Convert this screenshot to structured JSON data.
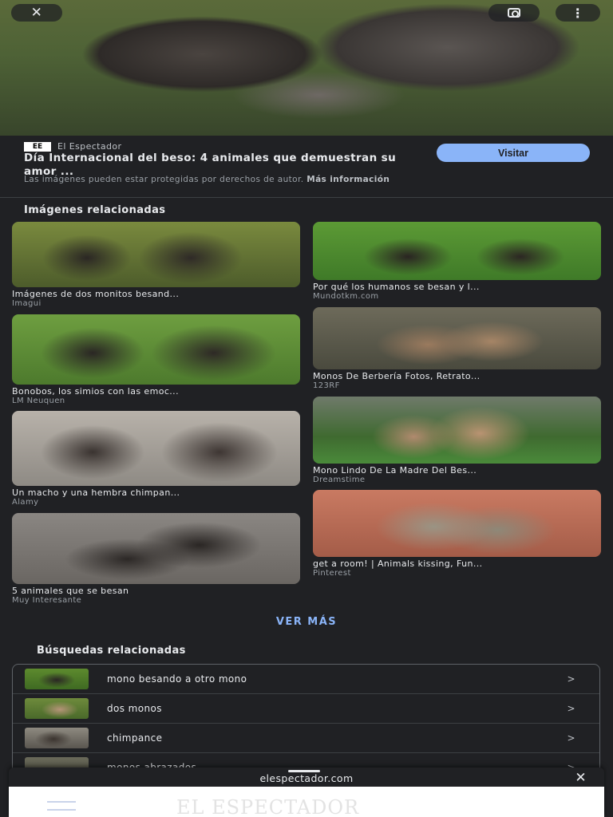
{
  "header": {
    "close_icon": "close-icon",
    "lens_icon": "google-lens-icon",
    "more_icon": "more-vert-icon",
    "close_glyph": "✕",
    "more_glyph": "⋮"
  },
  "source": {
    "logo_text": "EE",
    "name": "El Espectador",
    "title": "Día Internacional del beso: 4 animales que demuestran su amor ...",
    "visit_label": "Visitar",
    "copyright_text": "Las imágenes pueden estar protegidas por derechos de autor.",
    "more_info_label": "Más información"
  },
  "related": {
    "title": "Imágenes relacionadas",
    "left": [
      {
        "caption": "Imágenes de dos monitos besand...",
        "source": "Imagui"
      },
      {
        "caption": "Bonobos, los simios con las emoc...",
        "source": "LM Neuquen"
      },
      {
        "caption": "Un macho y una hembra chimpan...",
        "source": "Alamy"
      },
      {
        "caption": "5 animales que se besan",
        "source": "Muy Interesante"
      }
    ],
    "right": [
      {
        "caption": "Por qué los humanos se besan y l...",
        "source": "Mundotkm.com"
      },
      {
        "caption": "Monos De Berbería Fotos, Retrato...",
        "source": "123RF"
      },
      {
        "caption": "Mono Lindo De La Madre Del Bes...",
        "source": "Dreamstime"
      },
      {
        "caption": "get a room! | Animals kissing, Fun...",
        "source": "Pinterest"
      }
    ],
    "more_label": "VER MÁS"
  },
  "searches": {
    "title": "Búsquedas relacionadas",
    "items": [
      {
        "label": "mono besando a otro mono"
      },
      {
        "label": "dos monos"
      },
      {
        "label": "chimpance"
      },
      {
        "label": "monos abrazados"
      }
    ],
    "chevron": ">"
  },
  "sheet": {
    "domain": "elespectador.com",
    "close_glyph": "✕",
    "web_logo": "EL ESPECTADOR"
  },
  "colors": {
    "background": "#202124",
    "accent": "#8ab4f8"
  }
}
